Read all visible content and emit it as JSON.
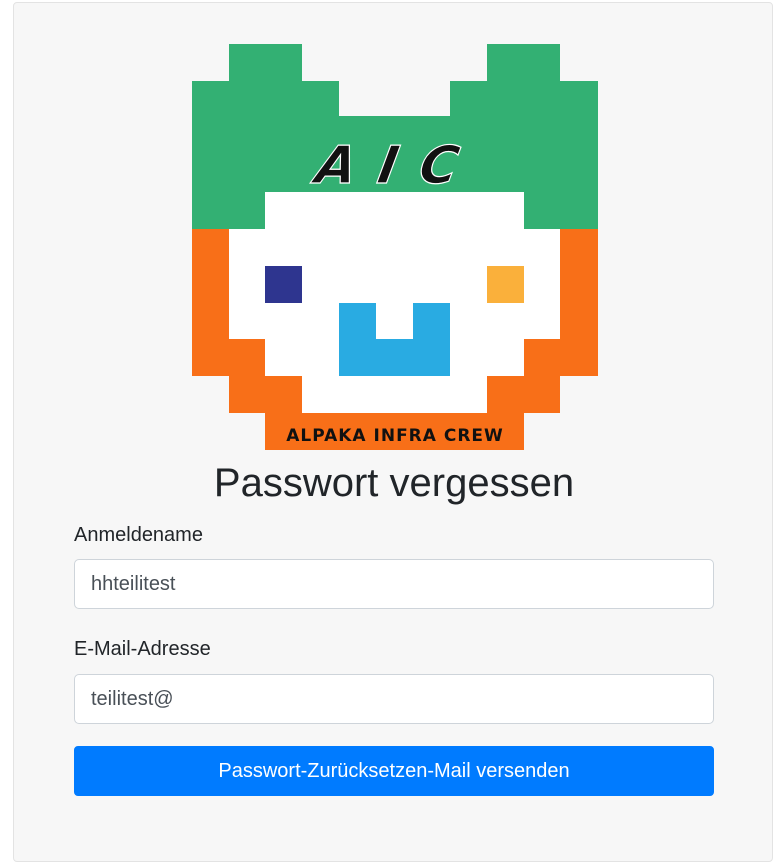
{
  "logo": {
    "letters": "AIC",
    "caption": "ALPAKA INFRA CREW",
    "colors": {
      "green": "#33b073",
      "orange": "#f86f18",
      "face": "#ffffff",
      "eye_left": "#2e358f",
      "eye_right": "#fab03b",
      "mouth": "#29abe2",
      "text": "#111111"
    }
  },
  "page": {
    "title": "Passwort vergessen"
  },
  "form": {
    "username": {
      "label": "Anmeldename",
      "value": "hhteilitest"
    },
    "email": {
      "label": "E-Mail-Adresse",
      "value": "teilitest@"
    },
    "submit_label": "Passwort-Zurücksetzen-Mail versenden"
  },
  "colors": {
    "primary": "#007bff",
    "card_background": "#f7f7f7"
  }
}
